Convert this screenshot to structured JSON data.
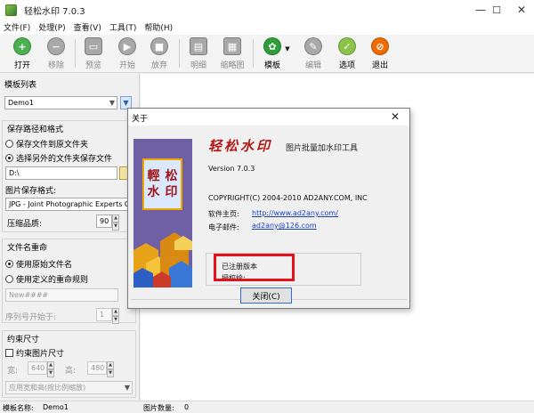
{
  "window": {
    "title": "轻松水印 7.0.3",
    "controls": [
      "—",
      "☐",
      "✕"
    ]
  },
  "menu": [
    "文件(F)",
    "处理(P)",
    "查看(V)",
    "工具(T)",
    "帮助(H)"
  ],
  "toolbar": {
    "buttons": [
      {
        "label": "打开",
        "icon": "plus-icon",
        "color": "#4caf50",
        "enabled": true
      },
      {
        "label": "移除",
        "icon": "minus-icon",
        "color": "#9e9e9e",
        "enabled": false
      },
      {
        "label": "预览",
        "icon": "monitor-icon",
        "color": "#9e9e9e",
        "enabled": false
      },
      {
        "label": "开始",
        "icon": "play-icon",
        "color": "#9e9e9e",
        "enabled": false
      },
      {
        "label": "放弃",
        "icon": "stop-icon",
        "color": "#9e9e9e",
        "enabled": false
      },
      {
        "label": "明细",
        "icon": "document-icon",
        "color": "#9e9e9e",
        "enabled": false
      },
      {
        "label": "缩略图",
        "icon": "grid-icon",
        "color": "#9e9e9e",
        "enabled": false
      },
      {
        "label": "模板",
        "icon": "template-icon",
        "color": "#2e9e3a",
        "enabled": true
      },
      {
        "label": "编辑",
        "icon": "pencil-icon",
        "color": "#9e9e9e",
        "enabled": false
      },
      {
        "label": "选项",
        "icon": "wrench-icon",
        "color": "#8bc34a",
        "enabled": true
      },
      {
        "label": "退出",
        "icon": "exit-icon",
        "color": "#ef6c00",
        "enabled": true
      }
    ]
  },
  "left_panel": {
    "template_section": {
      "title": "模板列表",
      "selected": "Demo1"
    },
    "save_section": {
      "title": "保存路径和格式",
      "radio_original": "保存文件到原文件夹",
      "radio_other": "选择另外的文件夹保存文件",
      "path_value": "D:\\",
      "format_label": "图片保存格式:",
      "format_value": "JPG - Joint Photographic Experts Gro",
      "quality_label": "压缩品质:",
      "quality_value": "90"
    },
    "rename_section": {
      "title": "文件名重命",
      "radio_keep": "使用原始文件名",
      "radio_custom": "使用定义的重命规则",
      "pattern_value": "New####",
      "start_label": "序列号开始于:",
      "start_value": "1"
    },
    "size_section": {
      "title": "约束尺寸",
      "checkbox": "约束图片尺寸",
      "width_label": "宽:",
      "width_value": "640",
      "height_label": "高:",
      "height_value": "480",
      "mode_value": "应用宽和高(按比例缩放)"
    }
  },
  "statusbar": {
    "template_label": "模板名称:",
    "template_value": "Demo1",
    "count_label": "图片数量:",
    "count_value": "0"
  },
  "about": {
    "title": "关于",
    "close_glyph": "✕",
    "logo_chars": [
      "輕",
      "松",
      "水",
      "印"
    ],
    "brand": "轻松水印",
    "subtitle": "图片批量加水印工具",
    "version": "Version  7.0.3",
    "copyright": "COPYRIGHT(C) 2004-2010 AD2ANY.COM, INC",
    "homepage_label": "软件主页:",
    "homepage_url": "http://www.ad2any.com/",
    "email_label": "电子邮件:",
    "email_value": "ad2any@126.com",
    "registered": "已注册版本",
    "licensed_to": "授权给:",
    "close_button": "关闭(C)",
    "highlight_color": "#e4111a"
  }
}
